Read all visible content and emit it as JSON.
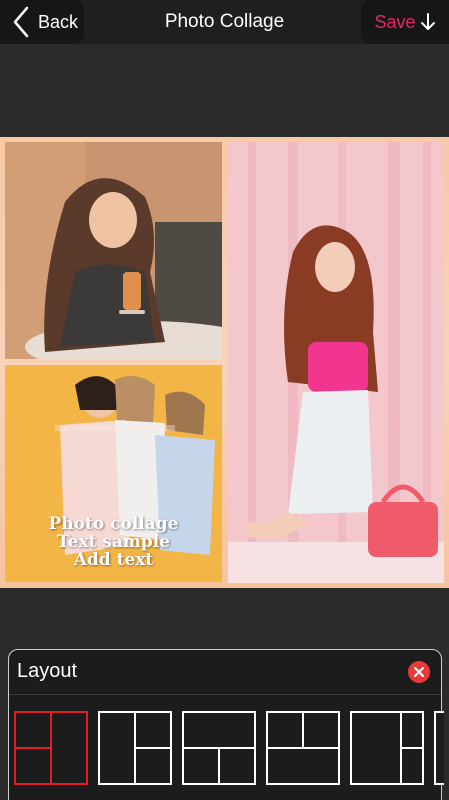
{
  "header": {
    "back_label": "Back",
    "title": "Photo Collage",
    "save_label": "Save"
  },
  "canvas": {
    "overlay_text": [
      "Photo collage",
      "Text sample",
      "Add text"
    ]
  },
  "layout_panel": {
    "title": "Layout",
    "selected_index": 0,
    "layouts": [
      "layout-1",
      "layout-2",
      "layout-3",
      "layout-4",
      "layout-5",
      "layout-6"
    ]
  },
  "colors": {
    "accent_save": "#e5256a",
    "close_button": "#e8393c",
    "selected_layout": "#e21d24"
  }
}
